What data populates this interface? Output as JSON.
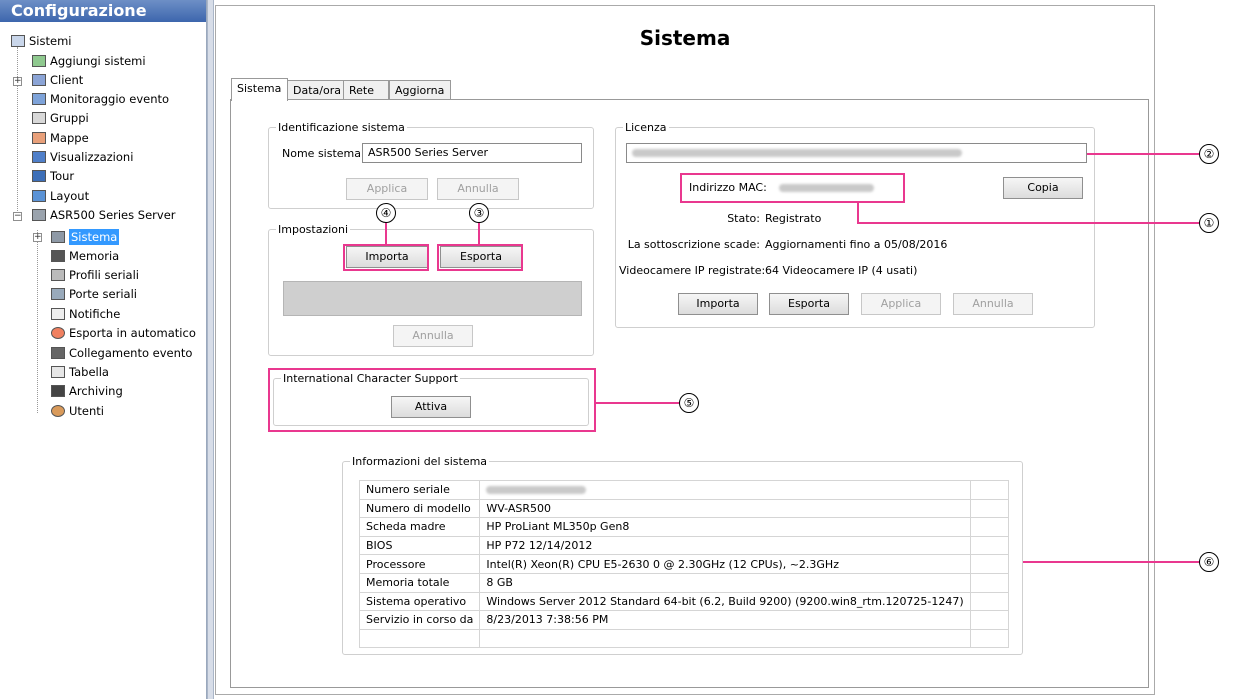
{
  "sidebar": {
    "title": "Configurazione",
    "root": "Sistemi",
    "items": [
      {
        "label": "Aggiungi sistemi",
        "icon": "add-system-icon"
      },
      {
        "label": "Client",
        "icon": "client-gear-icon"
      },
      {
        "label": "Monitoraggio evento",
        "icon": "event-monitor-icon"
      },
      {
        "label": "Gruppi",
        "icon": "groups-icon"
      },
      {
        "label": "Mappe",
        "icon": "map-icon"
      },
      {
        "label": "Visualizzazioni",
        "icon": "views-icon"
      },
      {
        "label": "Tour",
        "icon": "tour-icon"
      },
      {
        "label": "Layout",
        "icon": "layout-icon"
      }
    ],
    "server": "ASR500 Series Server",
    "server_items": [
      {
        "label": "Sistema",
        "icon": "system-icon",
        "selected": true
      },
      {
        "label": "Memoria",
        "icon": "storage-icon"
      },
      {
        "label": "Profili seriali",
        "icon": "serial-profile-icon"
      },
      {
        "label": "Porte seriali",
        "icon": "serial-port-icon"
      },
      {
        "label": "Notifiche",
        "icon": "mail-icon"
      },
      {
        "label": "Esporta in automatico",
        "icon": "auto-export-icon"
      },
      {
        "label": "Collegamento evento",
        "icon": "event-link-icon"
      },
      {
        "label": "Tabella",
        "icon": "table-icon"
      },
      {
        "label": "Archiving",
        "icon": "archive-icon"
      },
      {
        "label": "Utenti",
        "icon": "users-icon"
      }
    ]
  },
  "page": {
    "title": "Sistema",
    "tabs": [
      "Sistema",
      "Data/ora",
      "Rete",
      "Aggiorna"
    ]
  },
  "identification": {
    "legend": "Identificazione sistema",
    "name_label": "Nome sistema:",
    "name_value": "ASR500 Series Server",
    "apply": "Applica",
    "cancel": "Annulla"
  },
  "settings": {
    "legend": "Impostazioni",
    "import": "Importa",
    "export": "Esporta",
    "cancel": "Annulla"
  },
  "ics": {
    "legend": "International Character Support",
    "activate": "Attiva"
  },
  "license": {
    "legend": "Licenza",
    "mac_label": "Indirizzo MAC:",
    "copy": "Copia",
    "status_label": "Stato:",
    "status_value": "Registrato",
    "subscription_label": "La sottoscrizione scade:",
    "subscription_value": "Aggiornamenti fino a 05/08/2016",
    "cameras_label": "Videocamere IP registrate:",
    "cameras_value": "64 Videocamere IP (4 usati)",
    "import": "Importa",
    "export": "Esporta",
    "apply": "Applica",
    "cancel": "Annulla"
  },
  "sysinfo": {
    "legend": "Informazioni del sistema",
    "rows": [
      {
        "label": "Numero seriale",
        "value": ""
      },
      {
        "label": "Numero di modello",
        "value": "WV-ASR500"
      },
      {
        "label": "Scheda madre",
        "value": "HP ProLiant ML350p Gen8"
      },
      {
        "label": "BIOS",
        "value": "HP P72 12/14/2012"
      },
      {
        "label": "Processore",
        "value": "Intel(R) Xeon(R) CPU E5-2630 0 @ 2.30GHz (12 CPUs), ~2.3GHz"
      },
      {
        "label": "Memoria totale",
        "value": "8 GB"
      },
      {
        "label": "Sistema operativo",
        "value": "Windows Server 2012 Standard 64-bit (6.2, Build 9200) (9200.win8_rtm.120725-1247)"
      },
      {
        "label": "Servizio in corso da",
        "value": "8/23/2013 7:38:56 PM"
      }
    ]
  },
  "callouts": [
    "①",
    "②",
    "③",
    "④",
    "⑤",
    "⑥"
  ],
  "colors": {
    "highlight": "#e9388f",
    "selection": "#3399ff",
    "header": "#3d66ad"
  }
}
